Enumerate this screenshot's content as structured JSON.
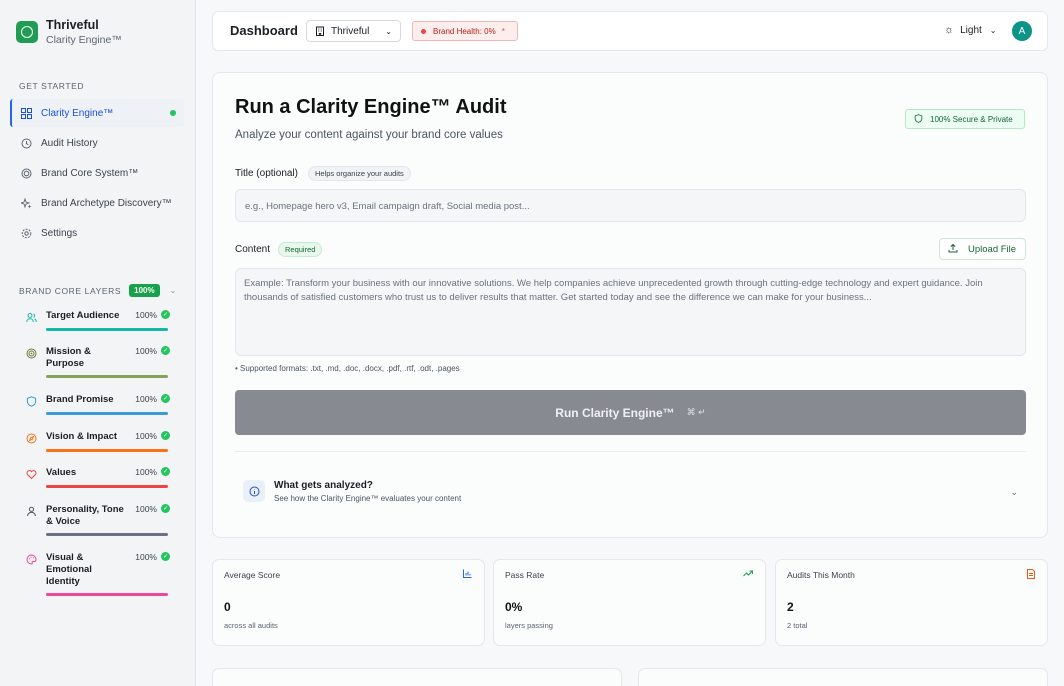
{
  "brand": {
    "name": "Thriveful",
    "subtitle": "Clarity Engine™"
  },
  "sidebar": {
    "get_started_label": "GET STARTED",
    "items": [
      {
        "label": "Clarity Engine™",
        "icon": "grid-icon"
      },
      {
        "label": "Audit History",
        "icon": "history-icon"
      },
      {
        "label": "Brand Core System™",
        "icon": "target-icon"
      },
      {
        "label": "Brand Archetype Discovery™",
        "icon": "sparkles-icon"
      },
      {
        "label": "Settings",
        "icon": "gear-icon"
      }
    ],
    "layers_label": "BRAND CORE LAYERS",
    "layers_badge": "100%",
    "layers": [
      {
        "name": "Target Audience",
        "pct": "100%",
        "color": "#14b8a6",
        "icon": "users-icon"
      },
      {
        "name": "Mission & Purpose",
        "pct": "100%",
        "color": "#84a35a",
        "icon": "target-icon"
      },
      {
        "name": "Brand Promise",
        "pct": "100%",
        "color": "#3b82f6",
        "icon": "shield-icon"
      },
      {
        "name": "Vision & Impact",
        "pct": "100%",
        "color": "#f97316",
        "icon": "compass-icon"
      },
      {
        "name": "Values",
        "pct": "100%",
        "color": "#ef4444",
        "icon": "heart-icon"
      },
      {
        "name": "Personality, Tone & Voice",
        "pct": "100%",
        "color": "#6b7280",
        "icon": "person-icon"
      },
      {
        "name": "Visual & Emotional Identity",
        "pct": "100%",
        "color": "#ec4899",
        "icon": "palette-icon"
      }
    ]
  },
  "topbar": {
    "title": "Dashboard",
    "workspace": "Thriveful",
    "health": "Brand Health: 0%",
    "health_mark": "*",
    "theme": "Light",
    "avatar": "A"
  },
  "audit": {
    "title": "Run a Clarity Engine™ Audit",
    "subtitle": "Analyze your content against your brand core values",
    "secure_badge": "100% Secure & Private",
    "title_label": "Title (optional)",
    "title_hint": "Helps organize your audits",
    "title_placeholder": "e.g., Homepage hero v3, Email campaign draft, Social media post...",
    "content_label": "Content",
    "content_required": "Required",
    "upload_label": "Upload File",
    "content_placeholder": "Example: Transform your business with our innovative solutions. We help companies achieve unprecedented growth through cutting-edge technology and expert guidance. Join thousands of satisfied customers who trust us to deliver results that matter. Get started today and see the difference we can make for your business...",
    "formats": "• Supported formats: .txt, .md, .doc, .docx, .pdf, .rtf, .odt, .pages",
    "run_label": "Run Clarity Engine™",
    "run_shortcut": "⌘ ↵",
    "what_title": "What gets analyzed?",
    "what_sub": "See how the Clarity Engine™ evaluates your content"
  },
  "stats": [
    {
      "title": "Average Score",
      "value": "0",
      "sub": "across all audits",
      "icon": "chart-icon",
      "color": "#2563eb"
    },
    {
      "title": "Pass Rate",
      "value": "0%",
      "sub": "layers passing",
      "icon": "trend-icon",
      "color": "#16a34a"
    },
    {
      "title": "Audits This Month",
      "value": "2",
      "sub": "2 total",
      "icon": "document-icon",
      "color": "#ea580c"
    }
  ]
}
